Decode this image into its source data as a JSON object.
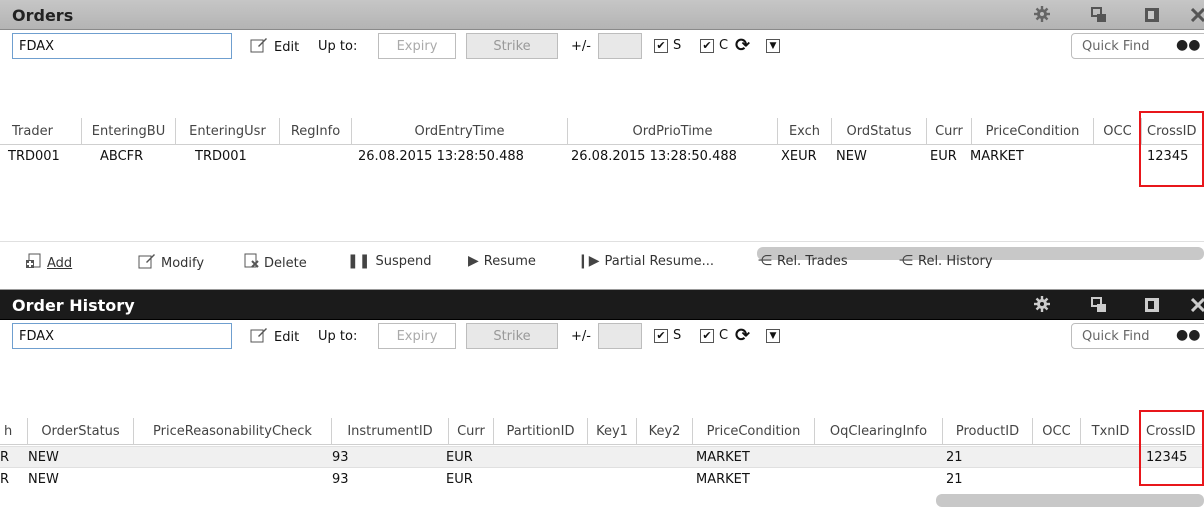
{
  "orders": {
    "title": "Orders",
    "toolbar": {
      "symbol": "FDAX",
      "edit_label": "Edit",
      "upto_label": "Up to:",
      "expiry_placeholder": "Expiry",
      "strike_placeholder": "Strike",
      "plusminus_label": "+/-",
      "s_label": "S",
      "c_label": "C",
      "s_checked": true,
      "c_checked": true,
      "quickfind_label": "Quick Find"
    },
    "columns": [
      "Trader",
      "EnteringBU",
      "EnteringUsr",
      "RegInfo",
      "OrdEntryTime",
      "OrdPrioTime",
      "Exch",
      "OrdStatus",
      "Curr",
      "PriceCondition",
      "OCC",
      "CrossID"
    ],
    "rows": [
      {
        "trader": "TRD001",
        "entering_bu": "ABCFR",
        "entering_usr": "TRD001",
        "reg_info": "",
        "ord_entry_time": "26.08.2015 13:28:50.488",
        "ord_prio_time": "26.08.2015 13:28:50.488",
        "exch": "XEUR",
        "ord_status": "NEW",
        "curr": "EUR",
        "price_condition": "MARKET",
        "occ": "",
        "cross_id": "12345"
      }
    ],
    "actions": {
      "add": "Add",
      "modify": "Modify",
      "delete": "Delete",
      "suspend": "Suspend",
      "resume": "Resume",
      "partial_resume": "Partial Resume...",
      "rel_trades": "Rel. Trades",
      "rel_history": "Rel. History"
    }
  },
  "history": {
    "title": "Order History",
    "toolbar": {
      "symbol": "FDAX",
      "edit_label": "Edit",
      "upto_label": "Up to:",
      "expiry_placeholder": "Expiry",
      "strike_placeholder": "Strike",
      "plusminus_label": "+/-",
      "s_label": "S",
      "c_label": "C",
      "s_checked": true,
      "c_checked": true,
      "quickfind_label": "Quick Find"
    },
    "columns": [
      "h",
      "OrderStatus",
      "PriceReasonabilityCheck",
      "InstrumentID",
      "Curr",
      "PartitionID",
      "Key1",
      "Key2",
      "PriceCondition",
      "OqClearingInfo",
      "ProductID",
      "OCC",
      "TxnID",
      "CrossID"
    ],
    "rows": [
      {
        "clipped": "R",
        "order_status": "NEW",
        "price_reasonability_check": "",
        "instrument_id": "93",
        "curr": "EUR",
        "partition_id": "",
        "key1": "",
        "key2": "",
        "price_condition": "MARKET",
        "oq_clearing_info": "",
        "product_id": "21",
        "occ": "",
        "txn_id": "",
        "cross_id": "12345"
      },
      {
        "clipped": "R",
        "order_status": "NEW",
        "price_reasonability_check": "",
        "instrument_id": "93",
        "curr": "EUR",
        "partition_id": "",
        "key1": "",
        "key2": "",
        "price_condition": "MARKET",
        "oq_clearing_info": "",
        "product_id": "21",
        "occ": "",
        "txn_id": "",
        "cross_id": ""
      }
    ]
  },
  "colors": {
    "highlight_box": "#e8161b",
    "orders_title_bg": "#bebebe",
    "history_title_bg": "#1b1b1b",
    "selected_row_bg": "#f0f0f0"
  }
}
